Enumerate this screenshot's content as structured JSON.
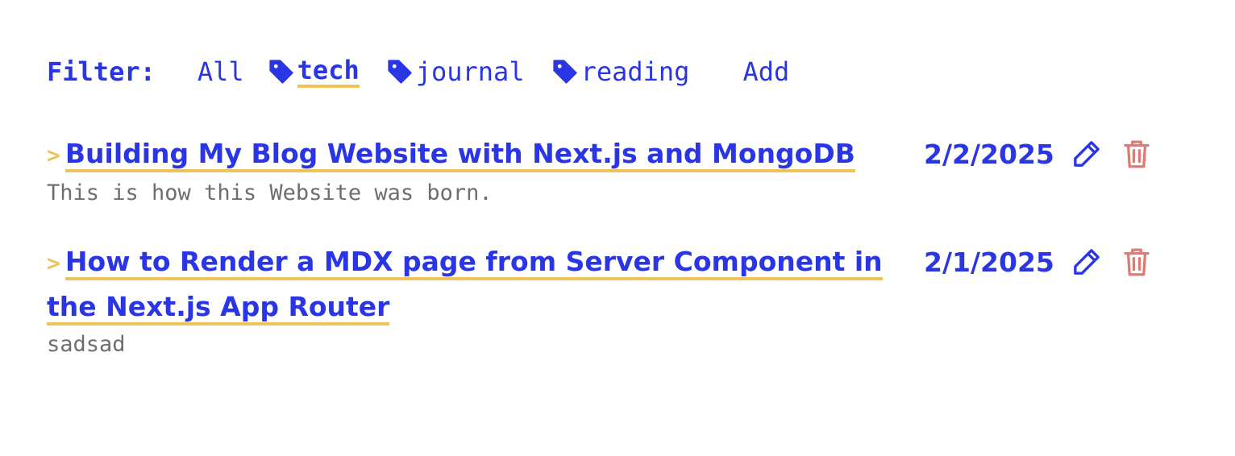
{
  "filter": {
    "label": "Filter:",
    "all_label": "All",
    "tags": [
      {
        "label": "tech",
        "active": true
      },
      {
        "label": "journal",
        "active": false
      },
      {
        "label": "reading",
        "active": false
      }
    ],
    "add_label": "Add"
  },
  "posts": [
    {
      "chevron": ">",
      "title": "Building My Blog Website with Next.js and MongoDB",
      "date": "2/2/2025",
      "description": "This is how this Website was born."
    },
    {
      "chevron": ">",
      "title": "How to Render a MDX page from Server Component in the Next.js App Router",
      "date": "2/1/2025",
      "description": "sadsad"
    }
  ],
  "icons": {
    "tag": "tag-icon",
    "edit": "pencil-icon",
    "delete": "trash-icon"
  },
  "colors": {
    "primary": "#2a36e6",
    "accent": "#ecc45a",
    "danger": "#e07a72",
    "muted": "#6e6e6e"
  }
}
